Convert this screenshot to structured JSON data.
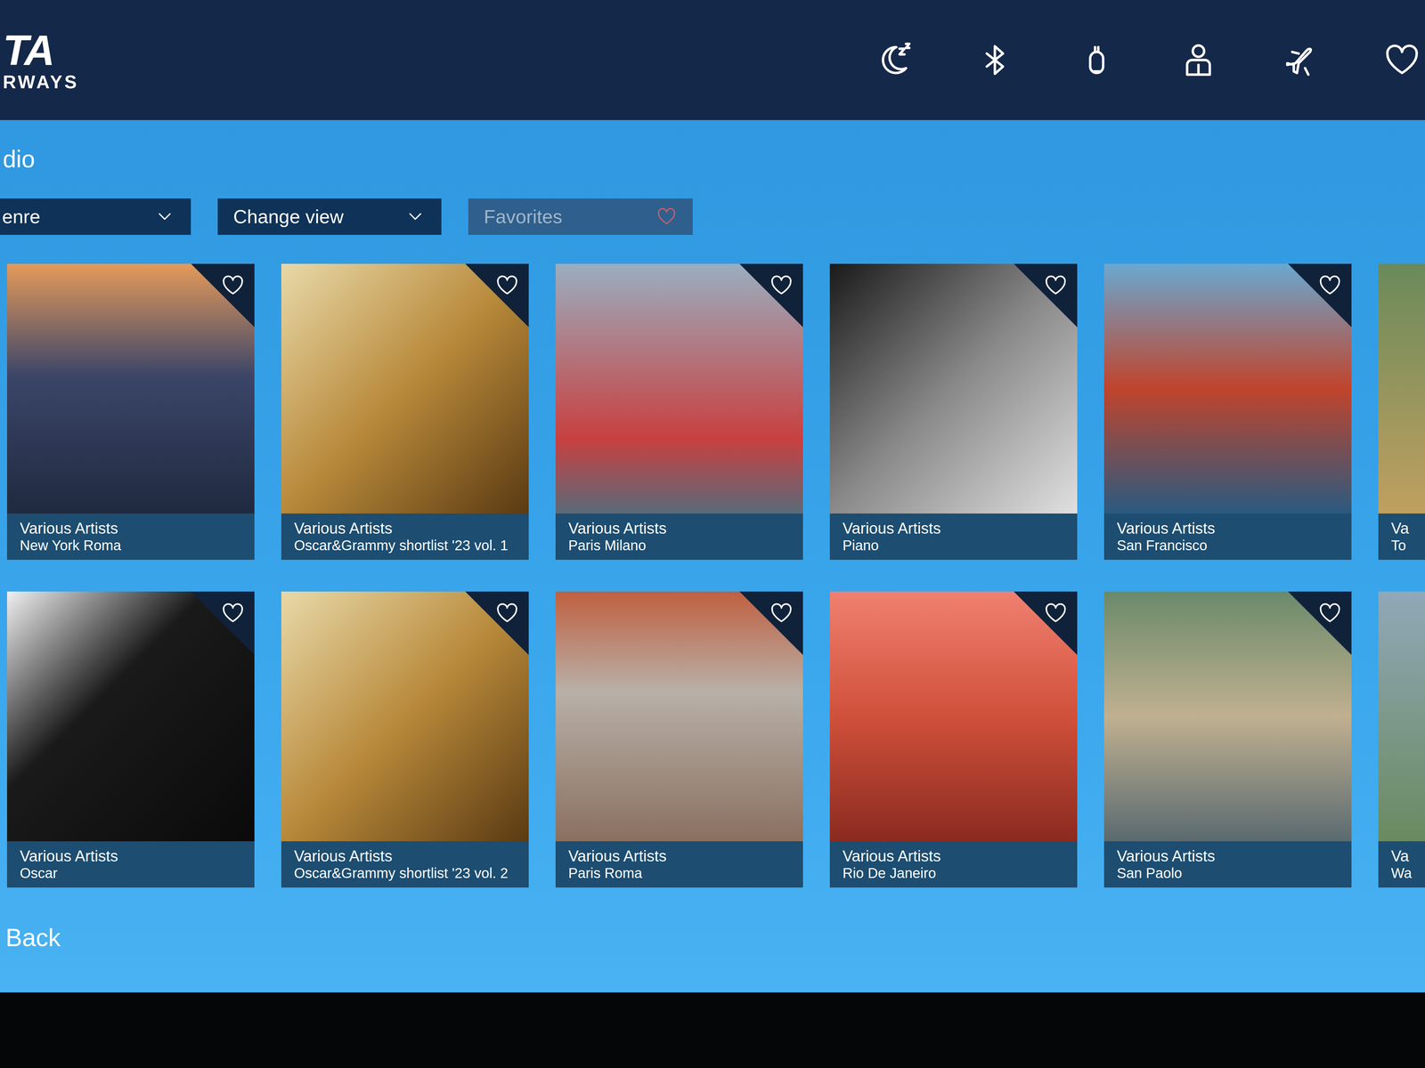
{
  "header": {
    "logo_top": "TA",
    "logo_bottom": "RWAYS"
  },
  "page": {
    "title": "dio"
  },
  "filters": [
    {
      "label": "enre",
      "kind": "dropdown",
      "disabled": false
    },
    {
      "label": "Change view",
      "kind": "dropdown",
      "disabled": false
    },
    {
      "label": "Favorites",
      "kind": "toggle",
      "disabled": true
    }
  ],
  "albums": [
    [
      {
        "artist": "Various Artists",
        "title": "New York Roma",
        "favorite": false
      },
      {
        "artist": "Various Artists",
        "title": "Oscar&Grammy shortlist '23 vol. 1",
        "favorite": false
      },
      {
        "artist": "Various Artists",
        "title": "Paris Milano",
        "favorite": false
      },
      {
        "artist": "Various Artists",
        "title": "Piano",
        "favorite": false
      },
      {
        "artist": "Various Artists",
        "title": "San Francisco",
        "favorite": false
      },
      {
        "artist": "Va",
        "title": "To",
        "favorite": false
      }
    ],
    [
      {
        "artist": "Various Artists",
        "title": "Oscar",
        "favorite": false
      },
      {
        "artist": "Various Artists",
        "title": "Oscar&Grammy shortlist '23 vol. 2",
        "favorite": false
      },
      {
        "artist": "Various Artists",
        "title": "Paris Roma",
        "favorite": false
      },
      {
        "artist": "Various Artists",
        "title": "Rio De Janeiro",
        "favorite": false
      },
      {
        "artist": "Various Artists",
        "title": "San Paolo",
        "favorite": false
      },
      {
        "artist": "Va",
        "title": "Wa",
        "favorite": false
      }
    ]
  ],
  "back": "Back"
}
